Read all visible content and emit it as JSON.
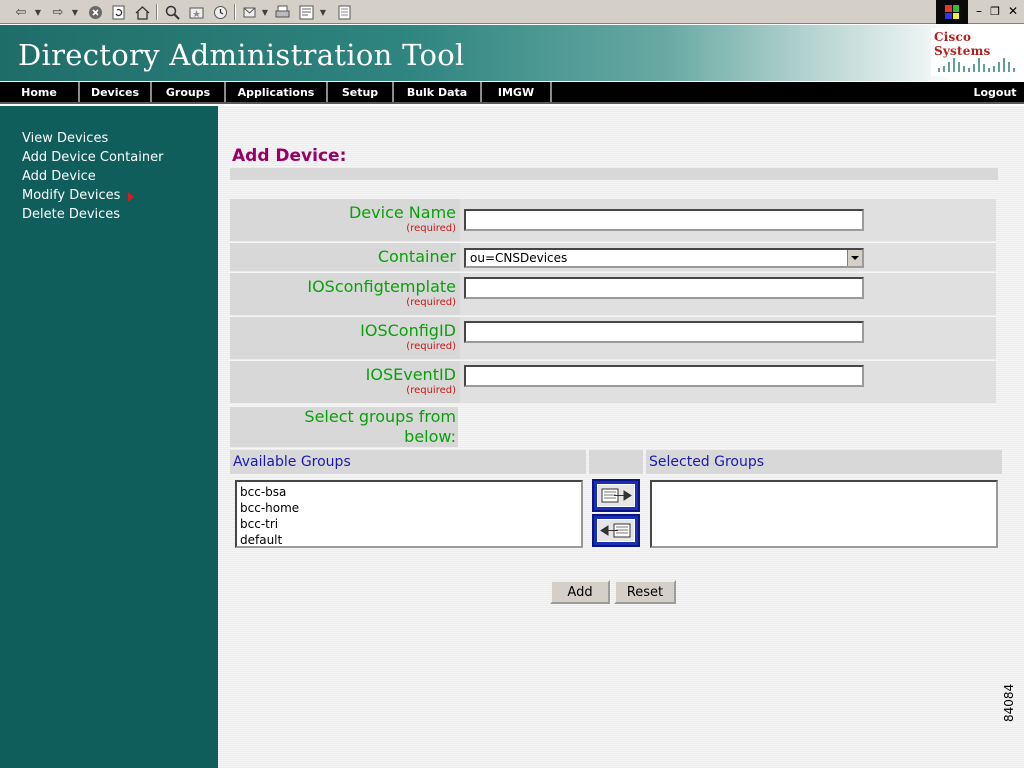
{
  "browser": {
    "toolbar_icons": [
      "back-icon",
      "forward-icon",
      "stop-icon",
      "refresh-icon",
      "home-icon",
      "search-icon",
      "favorites-icon",
      "history-icon",
      "mail-icon",
      "print-icon",
      "edit-icon",
      "discuss-icon"
    ],
    "window_controls": [
      "minimize-icon",
      "restore-icon",
      "close-icon"
    ]
  },
  "banner": {
    "title": "Directory Administration Tool",
    "logo_text": "Cisco Systems"
  },
  "nav": {
    "items": [
      "Home",
      "Devices",
      "Groups",
      "Applications",
      "Setup",
      "Bulk Data",
      "IMGW"
    ],
    "logout": "Logout"
  },
  "sidebar": {
    "items": [
      "View Devices",
      "Add Device Container",
      "Add Device",
      "Modify Devices",
      "Delete Devices"
    ],
    "submenu_arrow_color": "#d61c1c"
  },
  "form": {
    "title": "Add Device:",
    "required_text": "(required)",
    "fields": [
      {
        "label": "Device Name",
        "value": ""
      },
      {
        "label": "Container",
        "value": "ou=CNSDevices"
      },
      {
        "label": "IOSconfigtemplate",
        "value": ""
      },
      {
        "label": "IOSConfigID",
        "value": ""
      },
      {
        "label": "IOSEventID",
        "value": ""
      }
    ],
    "groups_prompt": "Select groups from below:",
    "available_groups_label": "Available Groups",
    "selected_groups_label": "Selected Groups",
    "available_groups": [
      "bcc-bsa",
      "bcc-home",
      "bcc-tri",
      "default"
    ],
    "selected_groups": [],
    "add_button": "Add",
    "reset_button": "Reset"
  },
  "figure_number": "84084",
  "colors": {
    "sidebar_bg": "#0f5e5c",
    "title_color": "#990066",
    "label_color": "#0aa00a",
    "required_color": "#c41818",
    "group_header_color": "#1a1ab0"
  }
}
